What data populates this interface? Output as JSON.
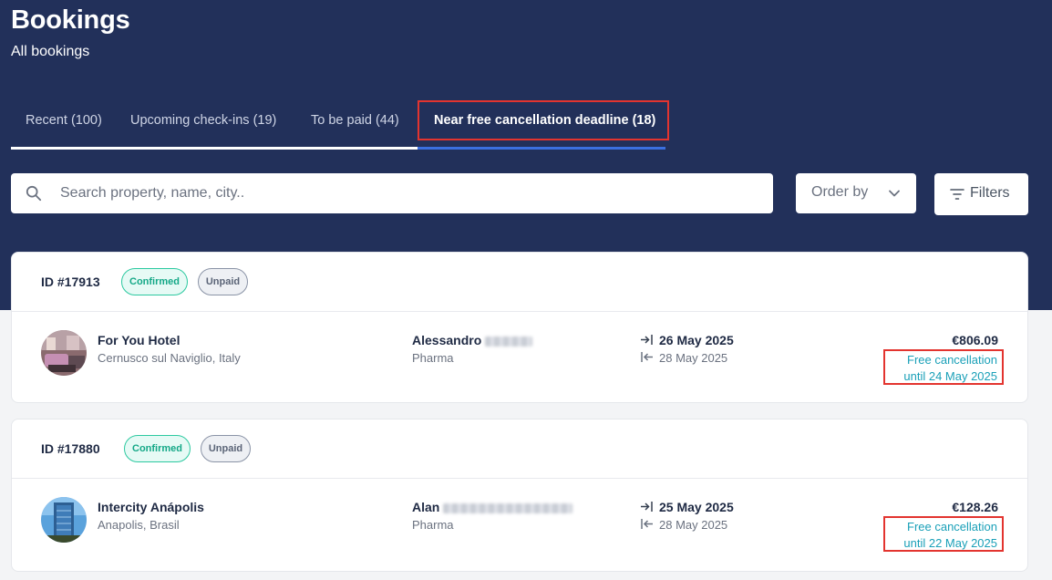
{
  "page": {
    "title": "Bookings",
    "subtitle": "All bookings"
  },
  "tabs": [
    {
      "label": "Recent (100)",
      "active": false
    },
    {
      "label": "Upcoming check-ins (19)",
      "active": false
    },
    {
      "label": "To be paid (44)",
      "active": false
    },
    {
      "label": "Near free cancellation deadline (18)",
      "active": true
    }
  ],
  "search": {
    "placeholder": "Search property, name, city..",
    "icon": "search-icon"
  },
  "order_by": {
    "label": "Order by",
    "icon": "chevron-down-icon"
  },
  "filters": {
    "label": "Filters",
    "icon": "filter-icon"
  },
  "colors": {
    "header_bg": "#22305a",
    "active_tab_underline": "#3b6fe0",
    "confirmed": "#14a887",
    "cancellation_text": "#1aa0b8",
    "highlight_box": "#e3342f"
  },
  "bookings": [
    {
      "id": "ID #17913",
      "status": "Confirmed",
      "payment": "Unpaid",
      "hotel": {
        "name": "For You Hotel",
        "location": "Cernusco sul Naviglio, Italy"
      },
      "guest": {
        "first_name": "Alessandro",
        "company": "Pharma"
      },
      "check_in": "26 May 2025",
      "check_out": "28 May 2025",
      "price": "€806.09",
      "cancellation": {
        "line1": "Free cancellation",
        "line2": "until 24 May 2025"
      }
    },
    {
      "id": "ID #17880",
      "status": "Confirmed",
      "payment": "Unpaid",
      "hotel": {
        "name": "Intercity Anápolis",
        "location": "Anapolis, Brasil"
      },
      "guest": {
        "first_name": "Alan",
        "company": "Pharma"
      },
      "check_in": "25 May 2025",
      "check_out": "28 May 2025",
      "price": "€128.26",
      "cancellation": {
        "line1": "Free cancellation",
        "line2": "until 22 May 2025"
      }
    }
  ]
}
